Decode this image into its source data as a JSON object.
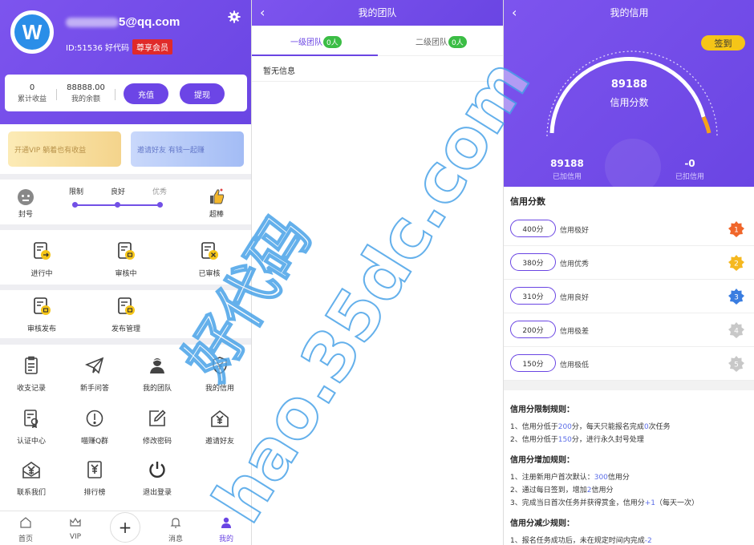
{
  "profile": {
    "email_suffix": "5@qq.com",
    "id_text": "ID:51536 好代码",
    "vip_badge": "尊享会员",
    "avatar_letter": "W"
  },
  "stats": {
    "earnings_value": "0",
    "earnings_label": "累计收益",
    "balance_value": "88888.00",
    "balance_label": "我的余额",
    "recharge_btn": "充值",
    "withdraw_btn": "提现"
  },
  "banners": {
    "vip": "开通VIP 躺着也有收益",
    "invite": "邀请好友 有钱一起赚"
  },
  "level": {
    "left_label": "封号",
    "right_label": "超棒",
    "steps": [
      "限制",
      "良好",
      "优秀"
    ]
  },
  "task_status": [
    {
      "label": "进行中"
    },
    {
      "label": "审核中"
    },
    {
      "label": "已审核"
    }
  ],
  "publish": [
    {
      "label": "审核发布"
    },
    {
      "label": "发布管理"
    }
  ],
  "menu": [
    {
      "label": "收支记录",
      "icon": "clipboard-icon"
    },
    {
      "label": "新手问答",
      "icon": "paper-plane-icon"
    },
    {
      "label": "我的团队",
      "icon": "team-icon"
    },
    {
      "label": "我的信用",
      "icon": "shield-icon"
    },
    {
      "label": "认证中心",
      "icon": "certificate-icon"
    },
    {
      "label": "喵赚Q群",
      "icon": "exclamation-icon"
    },
    {
      "label": "修改密码",
      "icon": "edit-icon"
    },
    {
      "label": "邀请好友",
      "icon": "yen-download-icon"
    },
    {
      "label": "联系我们",
      "icon": "yen-envelope-icon"
    },
    {
      "label": "排行榜",
      "icon": "yen-box-icon"
    },
    {
      "label": "退出登录",
      "icon": "power-icon"
    }
  ],
  "tabbar": [
    {
      "label": "首页",
      "icon": "home-icon"
    },
    {
      "label": "VIP",
      "icon": "crown-icon"
    },
    {
      "label": "消息",
      "icon": "bell-icon"
    },
    {
      "label": "我的",
      "icon": "person-icon"
    }
  ],
  "team": {
    "title": "我的团队",
    "tab1": "一级团队",
    "tab1_count": "0人",
    "tab2": "二级团队",
    "tab2_count": "0人",
    "empty": "暂无信息"
  },
  "credit": {
    "title": "我的信用",
    "sign_btn": "签到",
    "score": "89188",
    "score_label": "信用分数",
    "added_value": "89188",
    "added_label": "已加信用",
    "deducted_value": "-0",
    "deducted_label": "已扣信用",
    "section_title": "信用分数",
    "levels": [
      {
        "score": "400分",
        "desc": "信用极好",
        "medal": "1",
        "color": "#f0662a"
      },
      {
        "score": "380分",
        "desc": "信用优秀",
        "medal": "2",
        "color": "#f5b820"
      },
      {
        "score": "310分",
        "desc": "信用良好",
        "medal": "3",
        "color": "#3a7de0"
      },
      {
        "score": "200分",
        "desc": "信用极差",
        "medal": "4",
        "color": "#c8c8c8"
      },
      {
        "score": "150分",
        "desc": "信用极低",
        "medal": "5",
        "color": "#c8c8c8"
      }
    ],
    "rules": {
      "limit_title": "信用分限制规则：",
      "limit_1": [
        "1、信用分低于",
        "200",
        "分，每天只能报名完成",
        "0",
        "次任务"
      ],
      "limit_2": [
        "2、信用分低于",
        "150",
        "分，进行永久封号处理"
      ],
      "add_title": "信用分增加规则：",
      "add_1": [
        "1、注册新用户首次默认：",
        "300",
        "信用分"
      ],
      "add_2": [
        "2、通过每日签到，增加",
        "2",
        "信用分"
      ],
      "add_3": [
        "3、完成当日首次任务并获得赏金，信用分",
        "+1",
        "（每天一次）"
      ],
      "reduce_title": "信用分减少规则：",
      "reduce_1": [
        "1、报名任务成功后，未在规定时间内完成",
        "-2"
      ]
    }
  },
  "watermark": {
    "line1": "好代码",
    "line2": "hao.35dc.com"
  },
  "colors": {
    "primary": "#6a45e3",
    "badge_red": "#e02a2a",
    "count_green": "#3bbd45",
    "sign_yellow": "#f5c518",
    "watermark": "#4aa3e8"
  }
}
